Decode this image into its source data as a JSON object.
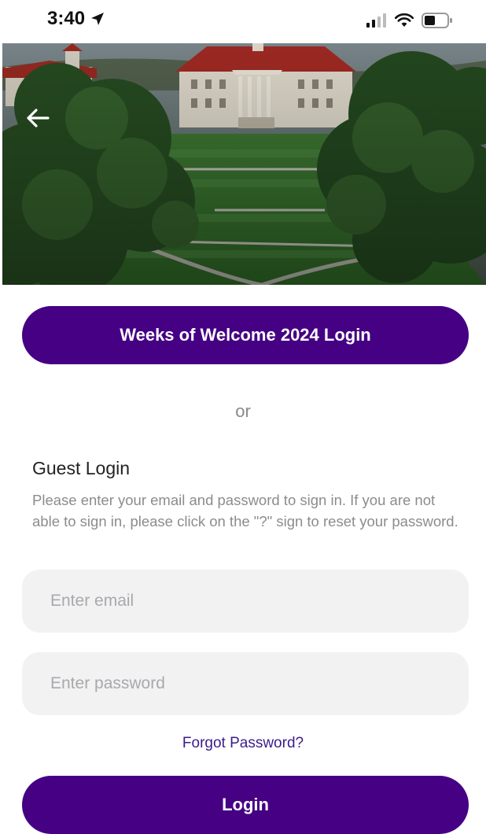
{
  "status_bar": {
    "time": "3:40",
    "icons": [
      "location-arrow-icon",
      "cellular-signal-icon",
      "wifi-icon",
      "battery-icon"
    ]
  },
  "hero": {
    "description": "campus-aerial-photo",
    "back_icon": "arrow-left-icon"
  },
  "sso_button": {
    "label": "Weeks of Welcome 2024 Login"
  },
  "divider": {
    "label": "or"
  },
  "guest": {
    "title": "Guest Login",
    "description": "Please enter your email and password to sign in. If you are not able to sign in, please click on the \"?\" sign to reset your password.",
    "email_placeholder": "Enter email",
    "password_placeholder": "Enter password",
    "forgot_label": "Forgot Password?",
    "login_label": "Login"
  },
  "colors": {
    "accent": "#450084",
    "field_bg": "#F2F2F3",
    "link": "#3B1C8C"
  }
}
